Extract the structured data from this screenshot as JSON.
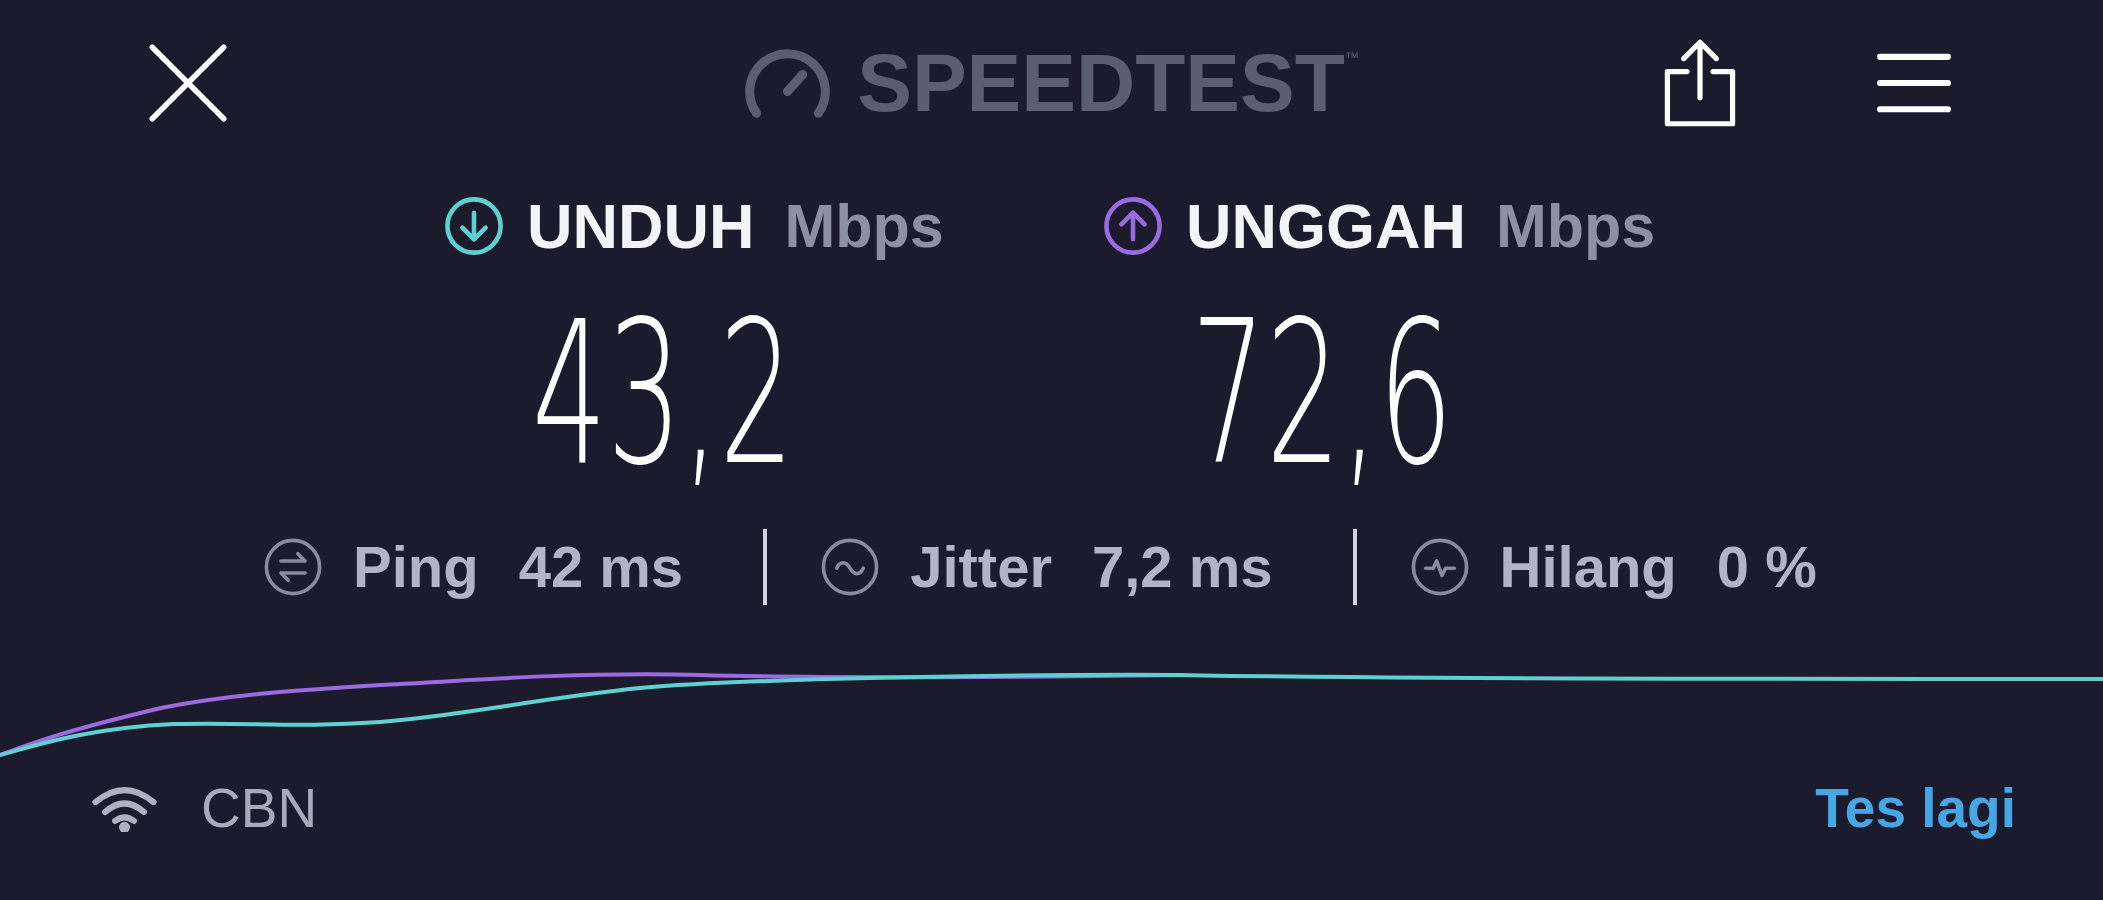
{
  "header": {
    "logo_text": "SPEEDTEST",
    "logo_mark": "™"
  },
  "results": [
    {
      "kind": "download",
      "label": "UNDUH",
      "unit": "Mbps",
      "value": "43,2",
      "color": "#5ed0d0"
    },
    {
      "kind": "upload",
      "label": "UNGGAH",
      "unit": "Mbps",
      "value": "72,6",
      "color": "#9a6ae0"
    }
  ],
  "stats": [
    {
      "kind": "ping",
      "label": "Ping",
      "value": "42 ms"
    },
    {
      "kind": "jitter",
      "label": "Jitter",
      "value": "7,2 ms"
    },
    {
      "kind": "loss",
      "label": "Hilang",
      "value": "0 %"
    }
  ],
  "footer": {
    "network": "CBN",
    "retry_link": "Tes lagi"
  }
}
